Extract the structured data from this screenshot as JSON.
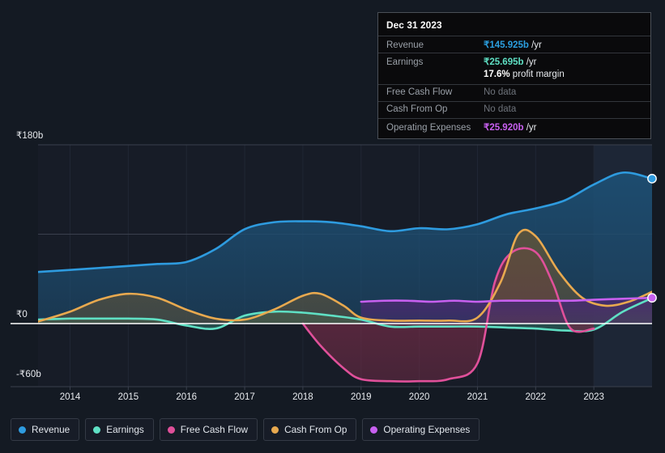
{
  "chart_data": {
    "type": "area",
    "title": "",
    "xlabel": "",
    "ylabel": "",
    "currency_symbol": "₹",
    "ylim": [
      -60,
      180
    ],
    "y_ticks": [
      {
        "label": "₹180b",
        "value": 180
      },
      {
        "label": "₹0",
        "value": 0
      },
      {
        "label": "-₹60b",
        "value": -60
      }
    ],
    "gridlines": [
      180,
      90,
      0
    ],
    "x_ticks": [
      "2014",
      "2015",
      "2016",
      "2017",
      "2018",
      "2019",
      "2020",
      "2021",
      "2022",
      "2023"
    ],
    "x_range": [
      2013.45,
      2024.0
    ],
    "grid": true,
    "legend_position": "bottom",
    "series": [
      {
        "name": "Revenue",
        "color": "#2e9bdf",
        "fill": "#1d4e72",
        "x": [
          2013.45,
          2014.0,
          2014.5,
          2015.0,
          2015.5,
          2016.0,
          2016.5,
          2017.0,
          2017.5,
          2018.0,
          2018.5,
          2019.0,
          2019.5,
          2020.0,
          2020.5,
          2021.0,
          2021.5,
          2022.0,
          2022.5,
          2023.0,
          2023.5,
          2024.0
        ],
        "values": [
          52,
          54,
          56,
          58,
          60,
          62,
          75,
          95,
          102,
          103,
          102,
          98,
          93,
          96,
          95,
          100,
          110,
          116,
          124,
          140,
          152,
          145.925
        ]
      },
      {
        "name": "Earnings",
        "color": "#5fe0c4",
        "fill": "#2f6b63",
        "x": [
          2013.45,
          2014.0,
          2014.5,
          2015.0,
          2015.5,
          2016.0,
          2016.5,
          2017.0,
          2017.5,
          2018.0,
          2018.5,
          2019.0,
          2019.5,
          2020.0,
          2020.5,
          2021.0,
          2021.5,
          2022.0,
          2022.5,
          2023.0,
          2023.5,
          2024.0
        ],
        "values": [
          4,
          5,
          5,
          5,
          4,
          -2,
          -5,
          8,
          12,
          11,
          8,
          4,
          -3,
          -3,
          -3,
          -3,
          -4,
          -5,
          -7,
          -6,
          12,
          25.695
        ]
      },
      {
        "name": "Free Cash Flow",
        "color": "#e0509a",
        "fill": "#6d2b45",
        "x": [
          2018.0,
          2018.3,
          2018.7,
          2019.0,
          2019.5,
          2020.0,
          2020.5,
          2021.0,
          2021.3,
          2021.6,
          2022.0,
          2022.3,
          2022.6,
          2023.0
        ],
        "values": [
          0,
          -22,
          -45,
          -56,
          -58,
          -58,
          -56,
          -40,
          42,
          72,
          72,
          40,
          -5,
          -5
        ]
      },
      {
        "name": "Cash From Op",
        "color": "#e8a94f",
        "fill": "#5a523c",
        "x": [
          2013.45,
          2014.0,
          2014.5,
          2015.0,
          2015.5,
          2016.0,
          2016.5,
          2017.0,
          2017.5,
          2018.0,
          2018.3,
          2018.7,
          2019.0,
          2019.5,
          2020.0,
          2020.5,
          2021.0,
          2021.4,
          2021.7,
          2022.0,
          2022.4,
          2022.8,
          2023.2,
          2023.6,
          2024.0
        ],
        "values": [
          2,
          12,
          24,
          30,
          26,
          14,
          5,
          4,
          14,
          28,
          30,
          18,
          6,
          3,
          3,
          3,
          6,
          42,
          90,
          88,
          52,
          26,
          18,
          22,
          32
        ]
      },
      {
        "name": "Operating Expenses",
        "color": "#c860f0",
        "fill": "#472b6e",
        "x": [
          2019.0,
          2019.4,
          2019.8,
          2020.2,
          2020.6,
          2021.0,
          2021.4,
          2021.8,
          2022.2,
          2022.6,
          2023.0,
          2023.5,
          2024.0
        ],
        "values": [
          22,
          23,
          23,
          22,
          23,
          22,
          23,
          23,
          23,
          23,
          24,
          25,
          25.92
        ]
      }
    ],
    "endpoints": [
      {
        "series": "Revenue",
        "value": 145.925,
        "color": "#2e9bdf"
      },
      {
        "series": "Operating Expenses",
        "value": 25.92,
        "color": "#c860f0"
      }
    ],
    "highlight_band": {
      "from": 2023.0,
      "to": 2024.0
    }
  },
  "tooltip": {
    "date": "Dec 31 2023",
    "rows": [
      {
        "key": "Revenue",
        "amount": "₹145.925b",
        "unit": " /yr",
        "color": "revenue",
        "no_data": false
      },
      {
        "key": "Earnings",
        "amount": "₹25.695b",
        "unit": " /yr",
        "color": "earnings",
        "no_data": false
      },
      {
        "key": "",
        "amount": "17.6%",
        "unit": " profit margin",
        "color": "white",
        "no_data": false,
        "sub": true
      },
      {
        "key": "Free Cash Flow",
        "amount": "No data",
        "unit": "",
        "color": "none",
        "no_data": true
      },
      {
        "key": "Cash From Op",
        "amount": "No data",
        "unit": "",
        "color": "none",
        "no_data": true
      },
      {
        "key": "Operating Expenses",
        "amount": "₹25.920b",
        "unit": " /yr",
        "color": "opex",
        "no_data": false
      }
    ]
  },
  "legend": {
    "items": [
      {
        "label": "Revenue",
        "color": "#2e9bdf"
      },
      {
        "label": "Earnings",
        "color": "#5fe0c4"
      },
      {
        "label": "Free Cash Flow",
        "color": "#e0509a"
      },
      {
        "label": "Cash From Op",
        "color": "#e8a94f"
      },
      {
        "label": "Operating Expenses",
        "color": "#c860f0"
      }
    ]
  }
}
